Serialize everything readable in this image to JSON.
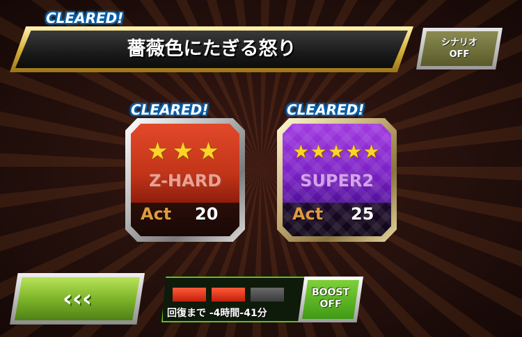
{
  "quest": {
    "cleared_label": "CLEARED!",
    "title": "薔薇色にたぎる怒り"
  },
  "scenario_button": {
    "line1": "シナリオ",
    "line2": "OFF"
  },
  "difficulties": [
    {
      "cleared_label": "CLEARED!",
      "stars": "★★★",
      "star_count": 3,
      "name": "Z-HARD",
      "act_label": "Act",
      "act_value": "20",
      "color": "#c23418"
    },
    {
      "cleared_label": "CLEARED!",
      "stars": "★★★★★",
      "star_count": 5,
      "name": "SUPER2",
      "act_label": "Act",
      "act_value": "25",
      "color": "#7a20c4"
    }
  ],
  "back_button": {
    "label": "‹‹‹"
  },
  "stamina": {
    "segments_filled": 2,
    "segments_total": 3,
    "recover_text": "回復まで -4時間-41分"
  },
  "boost_button": {
    "line1": "BOOST",
    "line2": "OFF"
  },
  "colors": {
    "accent_green": "#7db52a",
    "gauge_red": "#e03a1e",
    "cleared_blue": "#0a5fa8"
  }
}
